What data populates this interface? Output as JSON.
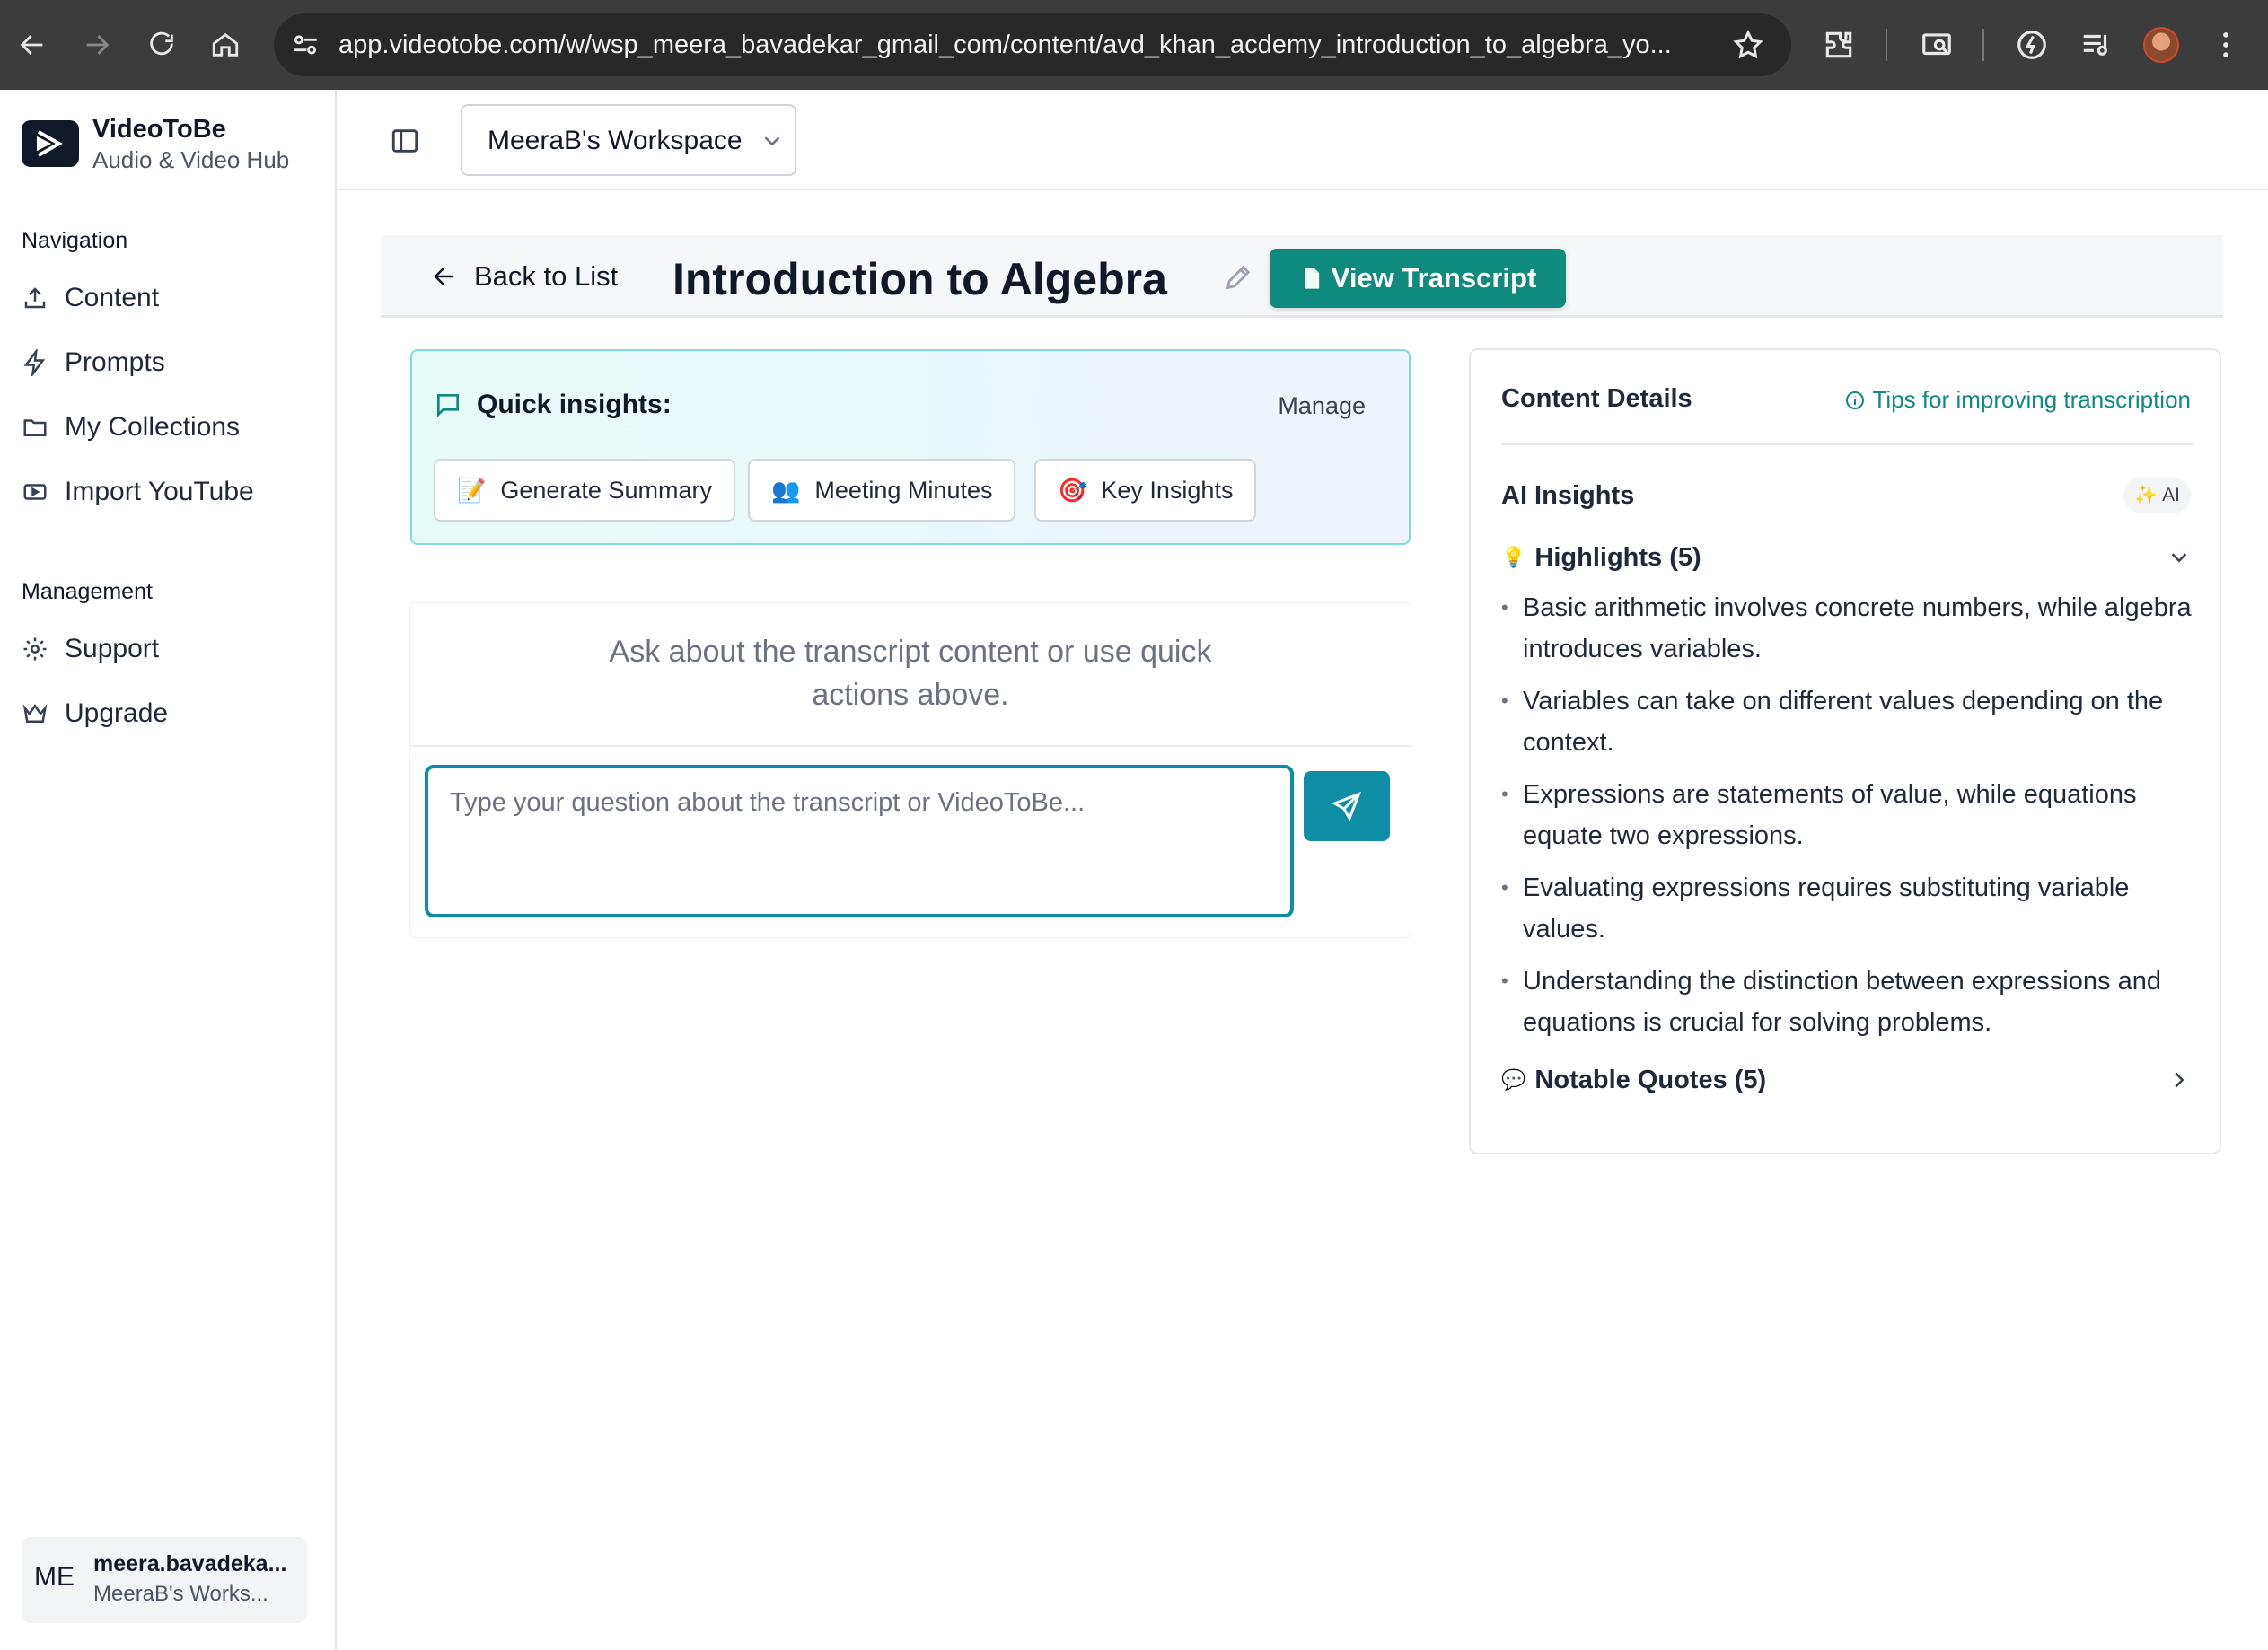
{
  "browser": {
    "url": "app.videotobe.com/w/wsp_meera_bavadekar_gmail_com/content/avd_khan_acdemy_introduction_to_algebra_yo..."
  },
  "sidebar": {
    "brand": "VideoToBe",
    "brand_sub": "Audio & Video Hub",
    "nav_label": "Navigation",
    "nav_items": [
      {
        "label": "Content",
        "icon": "upload-icon"
      },
      {
        "label": "Prompts",
        "icon": "bolt-icon"
      },
      {
        "label": "My Collections",
        "icon": "folder-icon"
      },
      {
        "label": "Import YouTube",
        "icon": "youtube-icon"
      }
    ],
    "mgmt_label": "Management",
    "mgmt_items": [
      {
        "label": "Support",
        "icon": "gear-icon"
      },
      {
        "label": "Upgrade",
        "icon": "crown-icon"
      }
    ],
    "user": {
      "initials": "ME",
      "email": "meera.bavadeka...",
      "workspace": "MeeraB's Works..."
    }
  },
  "header": {
    "workspace": "MeeraB's Workspace"
  },
  "page": {
    "back_label": "Back to List",
    "title": "Introduction to Algebra",
    "view_transcript": "View Transcript"
  },
  "insights": {
    "title": "Quick insights:",
    "manage": "Manage",
    "actions": [
      {
        "label": "Generate Summary",
        "emoji": "📝"
      },
      {
        "label": "Meeting Minutes",
        "emoji": "👥"
      },
      {
        "label": "Key Insights",
        "emoji": "🎯"
      }
    ]
  },
  "chat": {
    "empty_line1": "Ask about the transcript content or use quick",
    "empty_line2": "actions above.",
    "placeholder": "Type your question about the transcript or VideoToBe..."
  },
  "details": {
    "title": "Content Details",
    "tips": "Tips for improving transcription",
    "ai_title": "AI Insights",
    "ai_badge": "✨ AI",
    "highlights_label": "Highlights (5)",
    "highlights": [
      "Basic arithmetic involves concrete numbers, while algebra introduces variables.",
      "Variables can take on different values depending on the context.",
      "Expressions are statements of value, while equations equate two expressions.",
      "Evaluating expressions requires substituting variable values.",
      "Understanding the distinction between expressions and equations is crucial for solving problems."
    ],
    "quotes_label": "Notable Quotes (5)"
  },
  "colors": {
    "brand_teal": "#0f8a7f",
    "send_blue": "#0e8ea5",
    "chrome_dark": "#3c3c3c"
  }
}
